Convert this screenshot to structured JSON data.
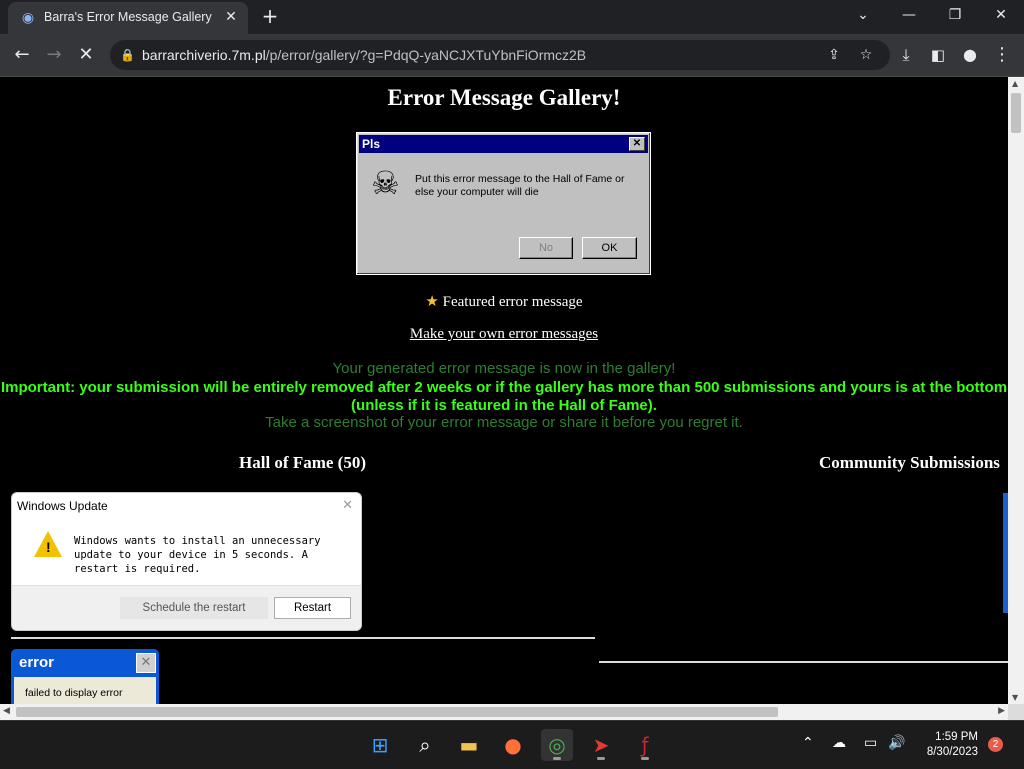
{
  "browser": {
    "tab": {
      "title": "Barra's Error Message Gallery"
    },
    "address": {
      "host": "barrarchiverio.7m.pl",
      "path": "/p/error/gallery/?g=PdqQ-yaNCJXTuYbnFiOrmcz2B"
    }
  },
  "page": {
    "heading": "Error Message Gallery!",
    "featured_dialog": {
      "title": "Pls",
      "message": "Put this error message to the Hall of Fame or else your computer will die",
      "buttons": {
        "no": "No",
        "ok": "OK"
      }
    },
    "featured_label": "Featured error message",
    "make_own_link": "Make your own error messages",
    "notice_generated": "Your generated error message is now in the gallery!",
    "notice_important": "Important: your submission will be entirely removed after 2 weeks or if the gallery has more than 500 submissions and yours is at the bottom (unless if it is featured in the Hall of Fame).",
    "notice_screenshot": "Take a screenshot of your error message or share it before you regret it.",
    "hall_of_fame_heading": "Hall of Fame (50)",
    "community_heading": "Community Submissions",
    "windows_update": {
      "title": "Windows Update",
      "message": "Windows wants to install an unnecessary update to your device in 5 seconds. A restart is required.",
      "schedule_button": "Schedule the restart",
      "restart_button": "Restart"
    },
    "xp_error": {
      "title": "error",
      "message": "failed to display error"
    }
  },
  "taskbar": {
    "time": "1:59 PM",
    "date": "8/30/2023",
    "notifications": "2"
  }
}
